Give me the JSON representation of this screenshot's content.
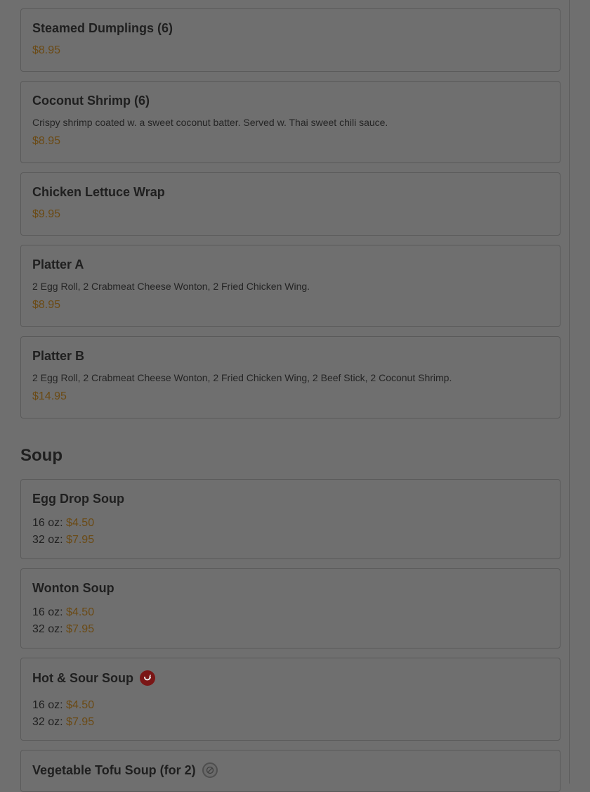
{
  "items_top": [
    {
      "name": "Steamed Dumplings (6)",
      "desc": "",
      "price": "$8.95"
    },
    {
      "name": "Coconut Shrimp (6)",
      "desc": "Crispy shrimp coated w. a sweet coconut batter. Served w. Thai sweet chili sauce.",
      "price": "$8.95"
    },
    {
      "name": "Chicken Lettuce Wrap",
      "desc": "",
      "price": "$9.95"
    },
    {
      "name": "Platter A",
      "desc": "2 Egg Roll, 2 Crabmeat Cheese Wonton, 2 Fried Chicken Wing.",
      "price": "$8.95"
    },
    {
      "name": "Platter B",
      "desc": "2 Egg Roll, 2 Crabmeat Cheese Wonton, 2 Fried Chicken Wing, 2 Beef Stick, 2 Coconut Shrimp.",
      "price": "$14.95"
    }
  ],
  "soup_section": {
    "title": "Soup",
    "items": [
      {
        "name": "Egg Drop Soup",
        "sizes": [
          {
            "label": "16 oz:",
            "price": "$4.50"
          },
          {
            "label": "32 oz:",
            "price": "$7.95"
          }
        ]
      },
      {
        "name": "Wonton Soup",
        "sizes": [
          {
            "label": "16 oz:",
            "price": "$4.50"
          },
          {
            "label": "32 oz:",
            "price": "$7.95"
          }
        ]
      },
      {
        "name": "Hot & Sour Soup",
        "icon": "spicy-icon",
        "sizes": [
          {
            "label": "16 oz:",
            "price": "$4.50"
          },
          {
            "label": "32 oz:",
            "price": "$7.95"
          }
        ]
      },
      {
        "name": "Vegetable Tofu Soup (for 2)",
        "icon": "vegetarian-icon"
      }
    ]
  },
  "colors": {
    "price": "#6b4a14",
    "spicy": "#7a1616",
    "overlay": "#6f6f6f"
  }
}
